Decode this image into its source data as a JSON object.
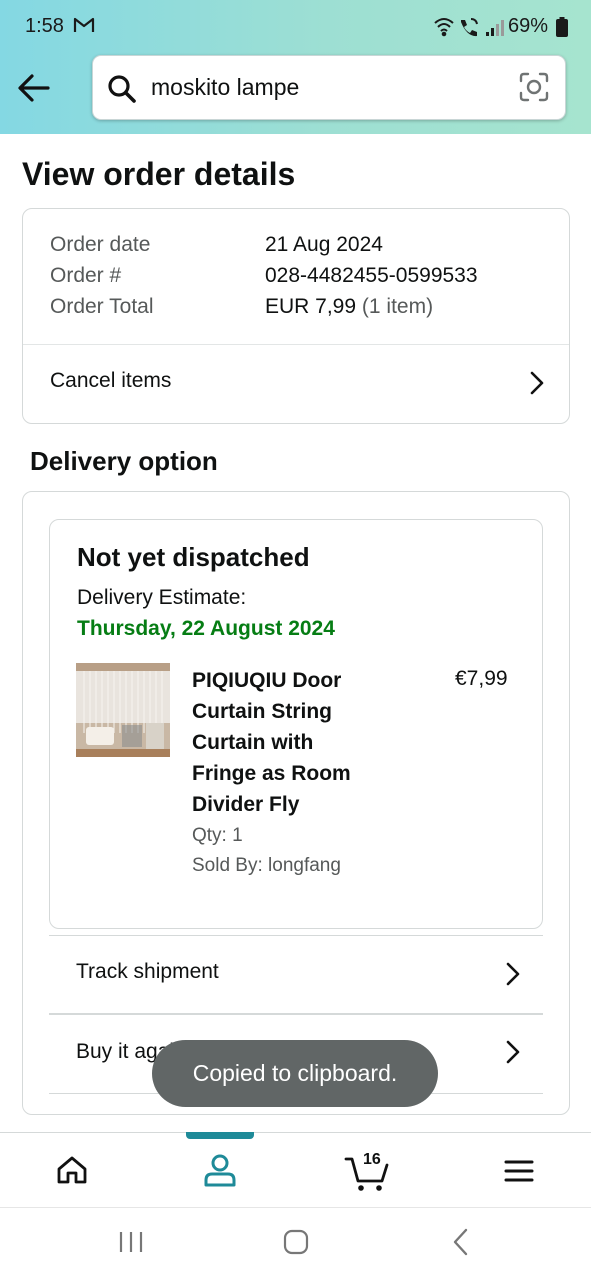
{
  "status_bar": {
    "time": "1:58",
    "battery": "69%",
    "icons": [
      "gmail-icon",
      "wifi-icon",
      "wifi-calling-icon",
      "signal-icon",
      "battery-icon"
    ]
  },
  "header": {
    "search_value": "moskito lampe",
    "icons": [
      "back-arrow-icon",
      "search-icon",
      "camera-icon"
    ]
  },
  "page": {
    "title": "View order details"
  },
  "order_summary": {
    "date_label": "Order date",
    "date_value": "21 Aug 2024",
    "number_label": "Order #",
    "number_value": "028-4482455-0599533",
    "total_label": "Order Total",
    "total_value": "EUR 7,99",
    "total_items": "(1 item)",
    "cancel_label": "Cancel items"
  },
  "delivery": {
    "heading": "Delivery option",
    "status": "Not yet dispatched",
    "estimate_label": "Delivery Estimate:",
    "estimate_date": "Thursday, 22 August 2024",
    "product": {
      "title": "PIQIUQIU Door Curtain String Curtain with Fringe as Room Divider Fly",
      "price": "€7,99",
      "qty": "Qty: 1",
      "sold_by": "Sold By: longfang"
    },
    "track_label": "Track shipment",
    "buy_again_label": "Buy it again"
  },
  "toast": {
    "message": "Copied to clipboard."
  },
  "bottom_nav": {
    "items": [
      "home-icon",
      "account-icon",
      "cart-icon",
      "menu-icon"
    ],
    "active": "account-icon",
    "cart_count": "16"
  },
  "colors": {
    "accent": "#1e8a98",
    "delivery_date": "#067d14",
    "toast_bg": "#616666"
  }
}
